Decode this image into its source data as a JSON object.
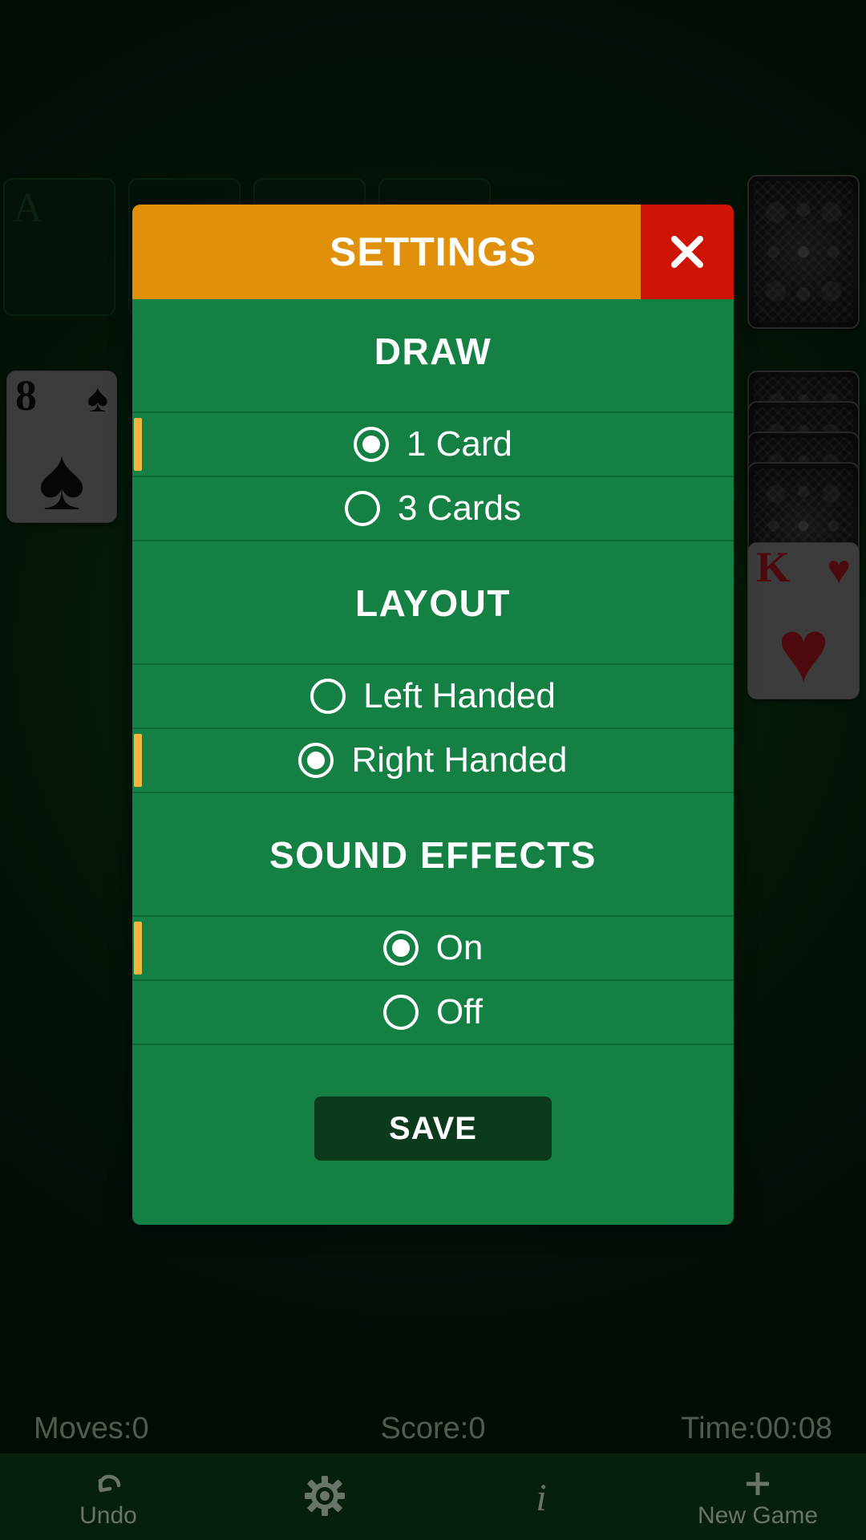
{
  "dialog": {
    "title": "SETTINGS",
    "close_icon": "close-icon",
    "save_label": "SAVE",
    "accent_orange": "#e0900a",
    "accent_red": "#cd1405",
    "body_green": "#148043",
    "marker_yellow": "#f5b63c",
    "sections": [
      {
        "title": "DRAW",
        "options": [
          {
            "label": "1 Card",
            "selected": true
          },
          {
            "label": "3 Cards",
            "selected": false
          }
        ]
      },
      {
        "title": "LAYOUT",
        "options": [
          {
            "label": "Left Handed",
            "selected": false
          },
          {
            "label": "Right Handed",
            "selected": true
          }
        ]
      },
      {
        "title": "SOUND EFFECTS",
        "options": [
          {
            "label": "On",
            "selected": true
          },
          {
            "label": "Off",
            "selected": false
          }
        ]
      }
    ]
  },
  "status": {
    "moves": "Moves:0",
    "score": "Score:0",
    "time": "Time:00:08"
  },
  "nav": {
    "items": [
      {
        "label": "Undo",
        "icon": "undo-icon"
      },
      {
        "label": "",
        "icon": "gear-icon"
      },
      {
        "label": "",
        "icon": "info-icon"
      },
      {
        "label": "New Game",
        "icon": "plus-icon"
      }
    ]
  },
  "board": {
    "cards": [
      {
        "rank": "8",
        "suit": "♠",
        "color": "black"
      },
      {
        "rank": "K",
        "suit": "♥",
        "color": "red"
      }
    ],
    "foundation_ghost": "A"
  }
}
